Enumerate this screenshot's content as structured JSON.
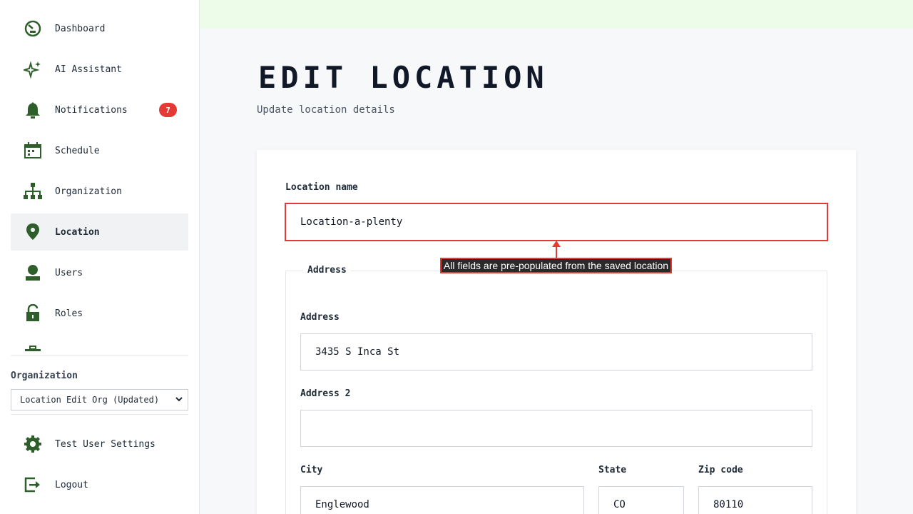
{
  "sidebar": {
    "items": [
      {
        "label": "Dashboard",
        "icon": "dashboard-icon"
      },
      {
        "label": "AI Assistant",
        "icon": "sparkle-icon"
      },
      {
        "label": "Notifications",
        "icon": "bell-icon",
        "badge": "7"
      },
      {
        "label": "Schedule",
        "icon": "calendar-icon"
      },
      {
        "label": "Organization",
        "icon": "org-chart-icon"
      },
      {
        "label": "Location",
        "icon": "map-pin-icon",
        "active": true
      },
      {
        "label": "Users",
        "icon": "user-icon"
      },
      {
        "label": "Roles",
        "icon": "lock-icon"
      }
    ],
    "organization_label": "Organization",
    "organization_selected": "Location Edit Org (Updated)",
    "bottom_items": [
      {
        "label": "Test User Settings",
        "icon": "gear-icon"
      },
      {
        "label": "Logout",
        "icon": "logout-icon"
      }
    ]
  },
  "page": {
    "title": "EDIT LOCATION",
    "subtitle": "Update location details"
  },
  "form": {
    "location_name_label": "Location name",
    "location_name_value": "Location-a-plenty",
    "address_group_legend": "Address",
    "address_label": "Address",
    "address_value": "3435 S Inca St",
    "address2_label": "Address 2",
    "address2_value": "",
    "city_label": "City",
    "city_value": "Englewood",
    "state_label": "State",
    "state_value": "CO",
    "zip_label": "Zip code",
    "zip_value": "80110"
  },
  "annotation": {
    "text": "All fields are pre-populated from the saved location"
  },
  "colors": {
    "accent_green": "#2e5e2a",
    "badge_red": "#e53935",
    "topbar_green": "#ecfce8",
    "highlight_red": "#e53935"
  }
}
